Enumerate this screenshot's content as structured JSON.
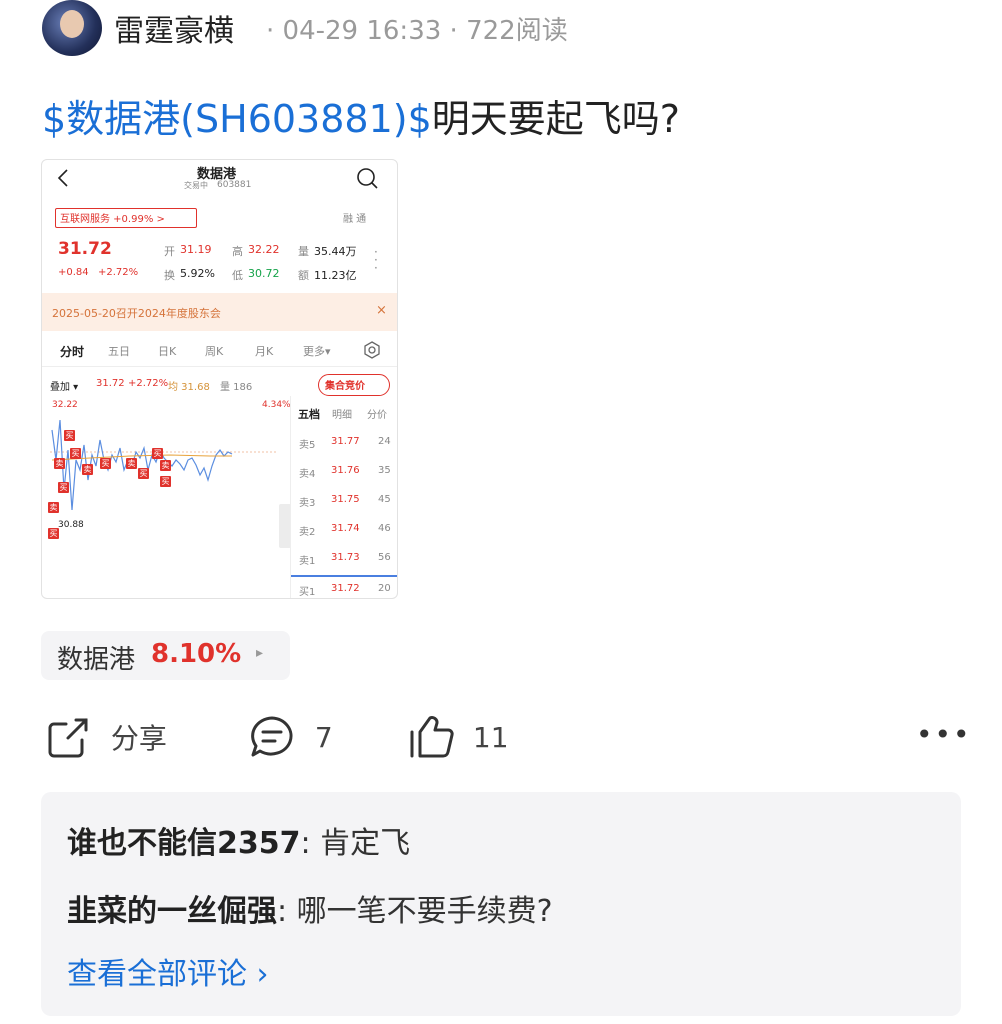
{
  "post": {
    "author": "雷霆豪横",
    "sep1": "·",
    "time": "04-29 16:33",
    "sep2": "·",
    "views": "722阅读",
    "title_link": "$数据港(SH603881)$",
    "title_rest": "明天要起飞吗?"
  },
  "screenshot": {
    "header_name": "数据港",
    "header_status": "交易中",
    "header_code": "603881",
    "sector_tag": "互联网服务 +0.99% >",
    "margin_labels": "融 通",
    "price": "31.72",
    "change": "+0.84",
    "change_pct": "+2.72%",
    "open_label": "开",
    "open_value": "31.19",
    "high_label": "高",
    "high_value": "32.22",
    "volume_label": "量",
    "volume_value": "35.44万",
    "turnover_label": "换",
    "turnover_value": "5.92%",
    "low_label": "低",
    "low_value": "30.72",
    "amount_label": "额",
    "amount_value": "11.23亿",
    "banner_text": "2025-05-20召开2024年度股东会",
    "banner_close": "×",
    "tabs": [
      "分时",
      "五日",
      "日K",
      "周K",
      "月K",
      "更多▾"
    ],
    "overlay_label": "叠加 ▾",
    "overlay_price": "31.72",
    "overlay_pct": "+2.72%",
    "avg_label": "均 31.68",
    "vol_label": "量 186",
    "auction_btn": "集合竞价",
    "chart_high": "32.22",
    "chart_high_pct": "4.34%",
    "chart_low": "30.88",
    "side_tabs": [
      "五档",
      "明细",
      "分价"
    ],
    "order_book": [
      {
        "label": "卖5",
        "price": "31.77",
        "qty": "24"
      },
      {
        "label": "卖4",
        "price": "31.76",
        "qty": "35"
      },
      {
        "label": "卖3",
        "price": "31.75",
        "qty": "45"
      },
      {
        "label": "卖2",
        "price": "31.74",
        "qty": "46"
      },
      {
        "label": "卖1",
        "price": "31.73",
        "qty": "56"
      },
      {
        "label": "买1",
        "price": "31.72",
        "qty": "20"
      }
    ],
    "buy_mark": "买",
    "sell_mark": "卖"
  },
  "stock_chip": {
    "name": "数据港",
    "change": "8.10%",
    "arrow": "▸"
  },
  "actions": {
    "share_label": "分享",
    "comment_count": "7",
    "like_count": "11",
    "more": "•••"
  },
  "comments": [
    {
      "user": "谁也不能信2357",
      "sep": ":",
      "text": "肯定飞"
    },
    {
      "user": "韭菜的一丝倔强",
      "sep": ":",
      "text": "哪一笔不要手续费?"
    }
  ],
  "view_all": "查看全部评论 ›",
  "colors": {
    "link": "#1a6fd6",
    "up": "#e0322c",
    "down": "#16a34a"
  }
}
